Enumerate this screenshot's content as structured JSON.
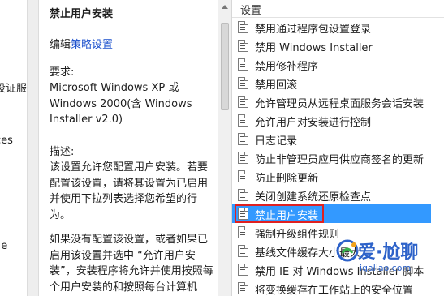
{
  "tree": {
    "items": [
      "设证服",
      "ces",
      "ile"
    ]
  },
  "description": {
    "title": "禁止用户安装",
    "edit_prefix": "编辑",
    "edit_link": "策略设置",
    "requirements_label": "要求:",
    "requirements_text": "Microsoft Windows XP 或 Windows 2000(含 Windows Installer v2.0)",
    "desc_label": "描述:",
    "desc_text": "该设置允许您配置用户安装。若要配置该设置，请将其设置为已启用并使用下拉列表选择您希望的行为。",
    "desc_text2": "如果没有配置该设置，或者如果已启用该设置并选中 “允许用户安装”，安装程序将允许并使用按照每个用户安装的和按照每台计算机"
  },
  "list": {
    "header": "设置",
    "items": [
      "禁用通过程序包设置登录",
      "禁用 Windows Installer",
      "禁用修补程序",
      "禁用回滚",
      "允许管理员从远程桌面服务会话安装",
      "允许用户对安装进行控制",
      "日志记录",
      "防止非管理员应用供应商签名的更新",
      "防止删除更新",
      "关闭创建系统还原检查点",
      "禁止用户安装",
      "强制升级组件规则",
      "基线文件缓存大小最大",
      "禁用 IE 对 Windows Installer 脚本",
      "将变换缓存在工作站上的安全位置"
    ],
    "selected_index": 10
  },
  "watermark": {
    "main": "爱·尬聊",
    "sub": "igaliao.com"
  },
  "colors": {
    "selection": "#3399ff",
    "highlight_box": "#e02020",
    "link": "#1a4fcc",
    "watermark": "#2d62c9"
  }
}
